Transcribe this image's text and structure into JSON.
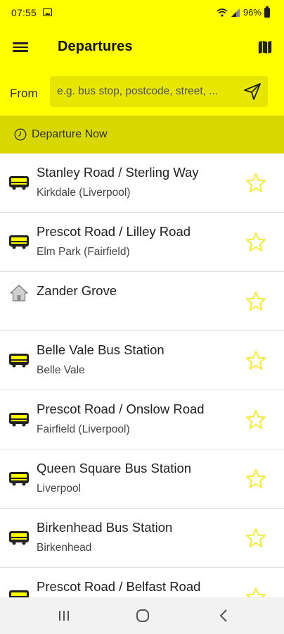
{
  "status_bar": {
    "time": "07:55",
    "battery": "96%"
  },
  "app_bar": {
    "title": "Departures"
  },
  "search": {
    "from_label": "From",
    "placeholder": "e.g. bus stop, postcode, street, ..."
  },
  "departure_now": {
    "label": "Departure Now"
  },
  "stops": [
    {
      "name": "Stanley Road / Sterling Way",
      "area": "Kirkdale (Liverpool)",
      "icon": "bus-icon"
    },
    {
      "name": "Prescot Road / Lilley Road",
      "area": "Elm Park (Fairfield)",
      "icon": "bus-icon"
    },
    {
      "name": "Zander Grove",
      "area": "",
      "icon": "home-icon"
    },
    {
      "name": "Belle Vale Bus Station",
      "area": "Belle Vale",
      "icon": "bus-icon"
    },
    {
      "name": "Prescot Road / Onslow Road",
      "area": "Fairfield (Liverpool)",
      "icon": "bus-icon"
    },
    {
      "name": "Queen Square Bus Station",
      "area": "Liverpool",
      "icon": "bus-icon"
    },
    {
      "name": "Birkenhead Bus Station",
      "area": "Birkenhead",
      "icon": "bus-icon"
    },
    {
      "name": "Prescot Road / Belfast Road",
      "area": "",
      "icon": "bus-icon"
    }
  ],
  "colors": {
    "brand_yellow": "#ffff00",
    "dark_yellow": "#d8d800",
    "star_yellow": "#f2ea3a"
  }
}
